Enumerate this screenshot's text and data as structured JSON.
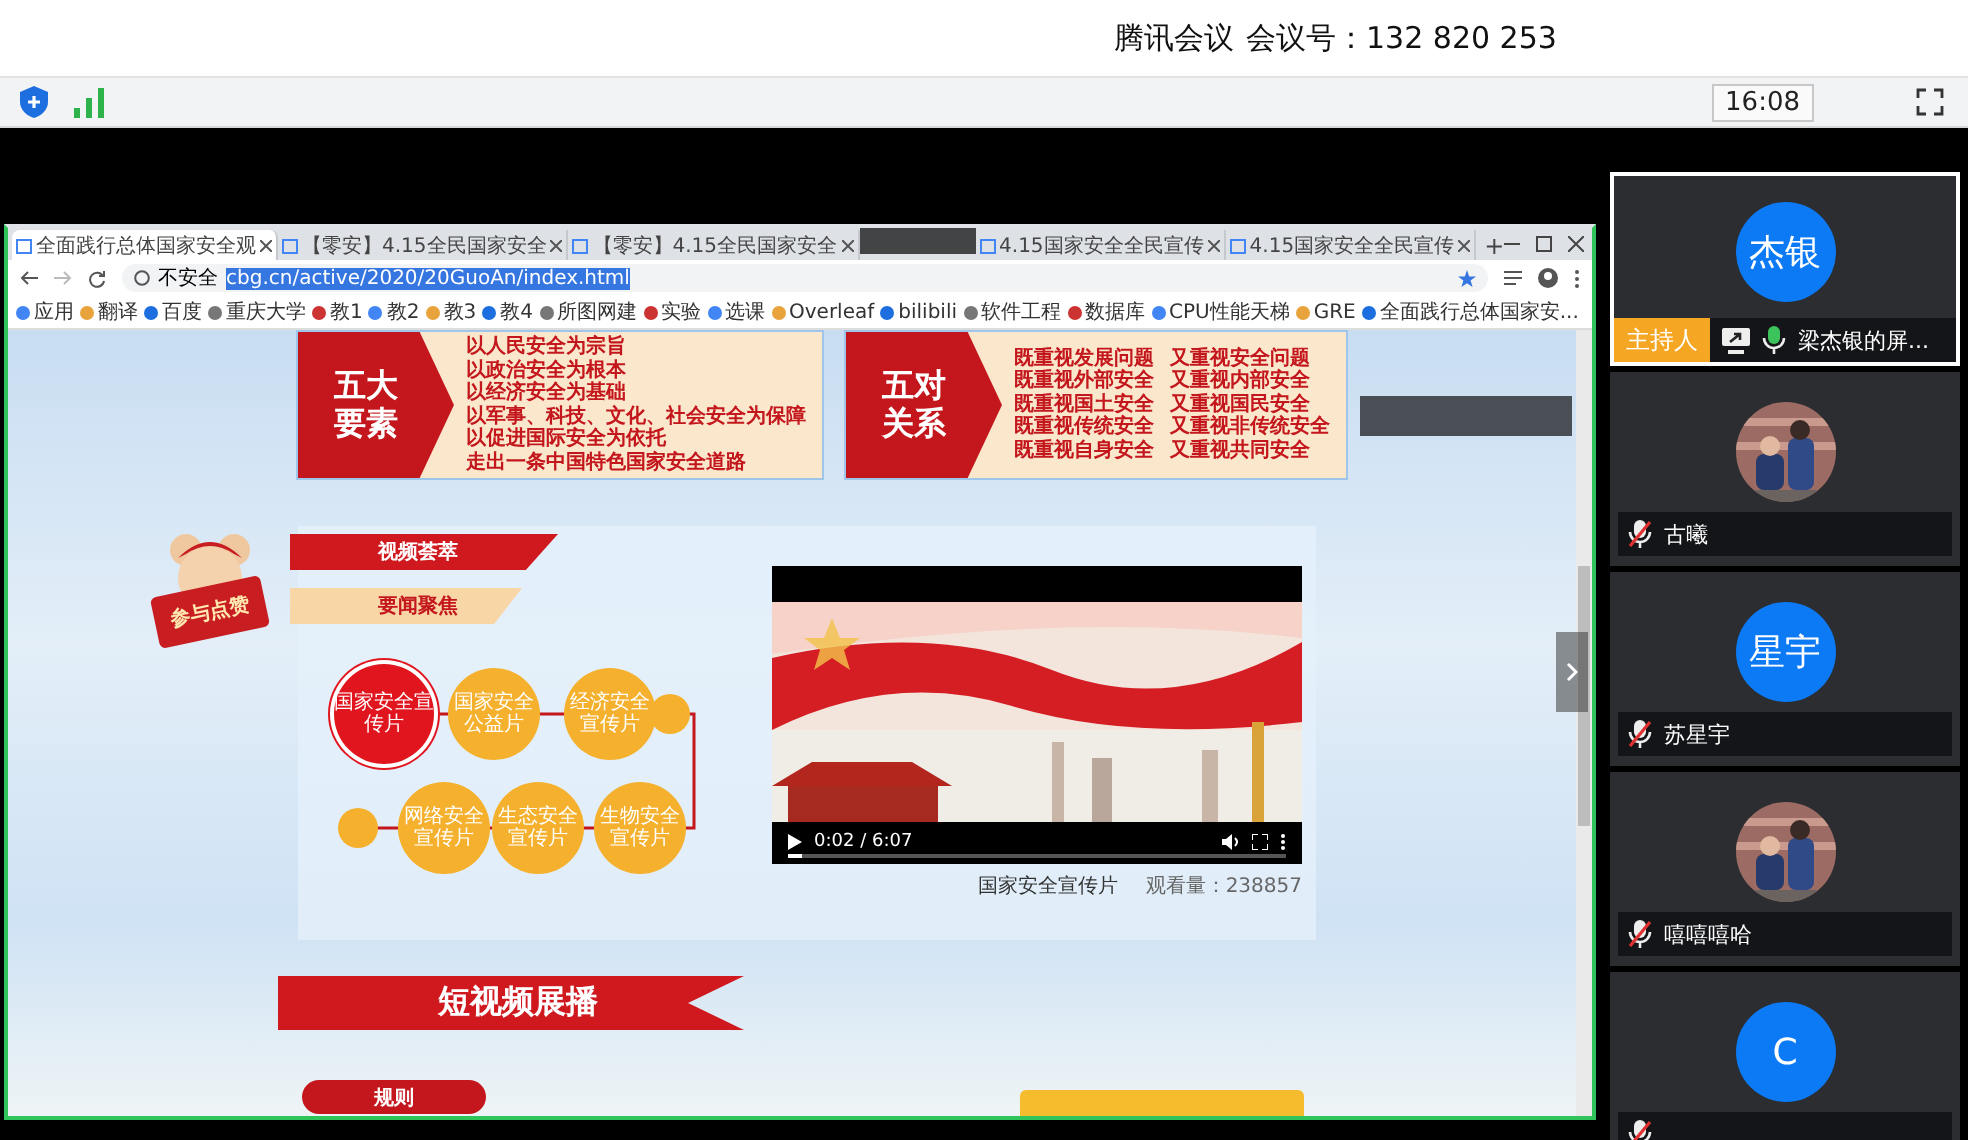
{
  "window": {
    "app_name": "腾讯会议",
    "meeting_id": "会议号：132 820 253"
  },
  "toolbar": {
    "time": "16:08"
  },
  "shared_screen": {
    "browser": {
      "tabs": [
        {
          "title": "全面践行总体国家安全观",
          "selected": true
        },
        {
          "title": "【零安】4.15全民国家安全",
          "selected": false
        },
        {
          "title": "【零安】4.15全民国家安全",
          "selected": false
        },
        {
          "title": "4.15国家安全全民宣传",
          "selected": false
        },
        {
          "title": "4.15国家安全全民宣传",
          "selected": false
        }
      ],
      "new_tab_label": "+",
      "address": {
        "security": "不安全",
        "url": "cbg.cn/active/2020/20GuoAn/index.html"
      },
      "bookmarks": [
        "应用",
        "翻译",
        "百度",
        "重庆大学",
        "教1",
        "教2",
        "教3",
        "教4",
        "所图网建",
        "实验",
        "选课",
        "Overleaf",
        "bilibili",
        "软件工程",
        "数据库",
        "CPU性能天梯",
        "GRE",
        "全面践行总体国家安..."
      ]
    },
    "page": {
      "banners": [
        {
          "heading": "五大要素",
          "columns": [
            [
              "以人民安全为宗旨",
              "以政治安全为根本",
              "以经济安全为基础",
              "以军事、科技、文化、社会安全为保障",
              "以促进国际安全为依托",
              "走出一条中国特色国家安全道路"
            ]
          ]
        },
        {
          "heading": "五对关系",
          "columns": [
            [
              "既重视发展问题",
              "既重视外部安全",
              "既重视国土安全",
              "既重视传统安全",
              "既重视自身安全"
            ],
            [
              "又重视安全问题",
              "又重视内部安全",
              "又重视国民安全",
              "又重视非传统安全",
              "又重视共同安全"
            ]
          ]
        }
      ],
      "mascot_sign": "参与点赞",
      "sections": [
        {
          "title": "视频荟萃",
          "selected": true
        },
        {
          "title": "要闻聚焦",
          "selected": false
        }
      ],
      "video_topics": [
        {
          "label": "国家安全宣传片",
          "selected": true
        },
        {
          "label": "国家安全公益片",
          "selected": false
        },
        {
          "label": "经济安全宣传片",
          "selected": false
        },
        {
          "label": "网络安全宣传片",
          "selected": false
        },
        {
          "label": "生态安全宣传片",
          "selected": false
        },
        {
          "label": "生物安全宣传片",
          "selected": false
        }
      ],
      "video": {
        "time": "0:02 / 6:07",
        "level": 0.03,
        "caption": "国家安全宣传片",
        "views": "观看量：238857"
      },
      "short_video_title": "短视频展播",
      "rules_button": "规则"
    }
  },
  "participants": [
    {
      "kind": "initials",
      "avatar_text": "杰银",
      "role_label": "主持人",
      "sharing": true,
      "muted": false,
      "name": "梁杰银的屏...",
      "selected": true
    },
    {
      "muted": true,
      "name": "古曦",
      "selected": false
    },
    {
      "kind": "initials",
      "avatar_text": "星宇",
      "muted": true,
      "name": "苏星宇",
      "selected": false
    },
    {
      "muted": true,
      "name": "嘻嘻嘻哈",
      "selected": false
    },
    {
      "kind": "initials",
      "avatar_text": "C",
      "muted": true,
      "selected": false
    }
  ]
}
